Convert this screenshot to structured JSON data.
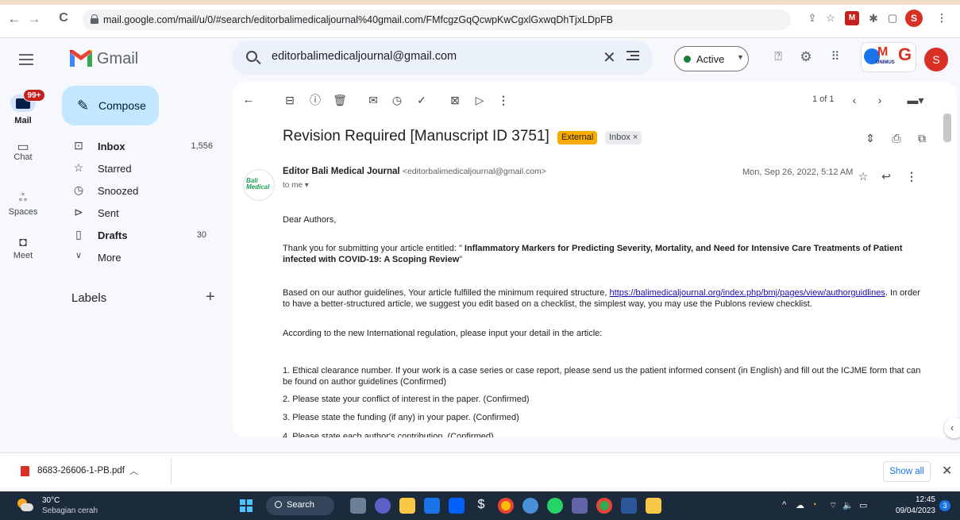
{
  "browser": {
    "url": "mail.google.com/mail/u/0/#search/editorbalimedicaljournal%40gmail.com/FMfcgzGqQcwpKwCgxlGxwqDhTjxLDpFB",
    "back": "←",
    "forward": "→",
    "reload": "C",
    "ext_avatar": "S"
  },
  "gmail": {
    "logo_text": "Gmail",
    "search_value": "editorbalimedicaljournal@gmail.com",
    "status": "Active",
    "profile_initial": "S",
    "org_logo_m": "M",
    "org_logo_g": "G",
    "org_logo_sub": "UNIMUS"
  },
  "rail": {
    "mail_badge": "99+",
    "mail_label": "Mail",
    "chat_label": "Chat",
    "spaces_label": "Spaces",
    "meet_label": "Meet"
  },
  "nav": {
    "compose": "Compose",
    "inbox": "Inbox",
    "inbox_count": "1,556",
    "starred": "Starred",
    "snoozed": "Snoozed",
    "sent": "Sent",
    "drafts": "Drafts",
    "drafts_count": "30",
    "more": "More",
    "labels": "Labels"
  },
  "mail": {
    "pager": "1 of 1",
    "subject": "Revision Required [Manuscript ID 3751]",
    "chip_external": "External",
    "chip_inbox": "Inbox ×",
    "avatar_text": "Bali Medical",
    "sender_name": "Editor Bali Medical Journal",
    "sender_email": "<editorbalimedicaljournal@gmail.com>",
    "to": "to me ▾",
    "date": "Mon, Sep 26, 2022, 5:12 AM",
    "greeting": "Dear Authors,",
    "p1_before": "Thank you for submitting your article entitled: \" ",
    "p1_title": "Inflammatory Markers for Predicting Severity, Mortality, and Need for Intensive Care Treatments of Patient infected with COVID-19: A Scoping Review",
    "p1_after": "\"",
    "p2_before": "Based on our author guidelines, Your article fulfilled the minimum required structure, ",
    "p2_link": "https://balimedicaljournal.org/index.php/bmj/pages/view/authorguidlines",
    "p2_after": ". In order to have a better-structured article, we suggest you edit based on a checklist, the simplest way, you may use the Publons review checklist.",
    "p3": "According to the new International regulation, please input your detail in the article:",
    "item1": "1. Ethical clearance number. If your work is a case series or case report, please send us the patient informed consent (in English) and fill out the ICJME form that can be found on author guidelines (Confirmed)",
    "item2": "2. Please state your conflict of interest in the paper.  (Confirmed)",
    "item3": "3. Please state the funding (if any) in your paper.   (Confirmed)",
    "item4": "4. Please state each author's contribution.  (Confirmed)"
  },
  "downloads": {
    "file_name": "8683-26606-1-PB.pdf",
    "show_all": "Show all"
  },
  "taskbar": {
    "temp": "30°C",
    "weather": "Sebagian cerah",
    "search": "Search",
    "time": "12:45",
    "date": "09/04/2023",
    "notifications": "3"
  },
  "colors": {
    "compose_bg": "#c2e7ff",
    "search_bg": "#eaf1fb",
    "external_chip": "#f9ab00",
    "badge_red": "#c5221f",
    "active_green": "#188038"
  }
}
